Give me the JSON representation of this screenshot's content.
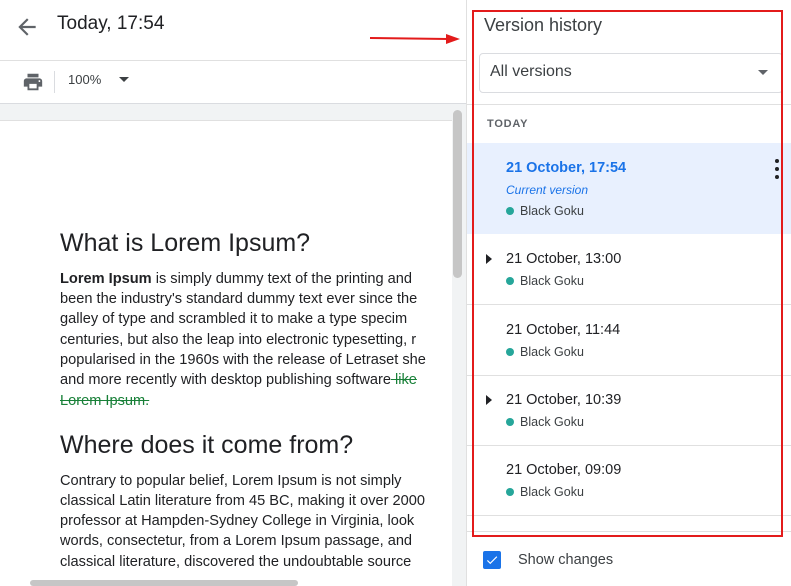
{
  "header": {
    "title": "Today, 17:54",
    "back_icon": "arrow-back-icon"
  },
  "toolbar": {
    "print_icon": "print-icon",
    "zoom": "100%"
  },
  "document": {
    "heading1": "What is Lorem Ipsum?",
    "para1": {
      "bold_lead": "Lorem Ipsum",
      "line1_rest": " is simply dummy text of the printing and",
      "line2": "been the industry's standard dummy text ever since the",
      "line3": "galley of type and scrambled it to make a type specim",
      "line4": "centuries, but also the leap into electronic typesetting, r",
      "line5": "popularised in the 1960s with the release of Letraset she",
      "line6": "and more recently with desktop publishing software",
      "line6_deleted": " like",
      "line7_deleted": "Lorem Ipsum."
    },
    "heading2": "Where does it come from?",
    "para2": {
      "line1": "Contrary to popular belief, Lorem Ipsum is not simply",
      "line2": "classical Latin literature from 45 BC, making it over 2000",
      "line3": "professor at Hampden-Sydney College in Virginia, look",
      "line4": "words, consectetur, from a Lorem Ipsum passage, and",
      "line5": "classical literature, discovered the undoubtable source"
    }
  },
  "panel": {
    "title": "Version history",
    "filter_value": "All versions",
    "section": "TODAY",
    "versions": [
      {
        "date": "21 October, 17:54",
        "current": "Current version",
        "author": "Black Goku",
        "expandable": false,
        "active": true
      },
      {
        "date": "21 October, 13:00",
        "author": "Black Goku",
        "expandable": true,
        "active": false
      },
      {
        "date": "21 October, 11:44",
        "author": "Black Goku",
        "expandable": false,
        "active": false
      },
      {
        "date": "21 October, 10:39",
        "author": "Black Goku",
        "expandable": true,
        "active": false
      },
      {
        "date": "21 October, 09:09",
        "author": "Black Goku",
        "expandable": false,
        "active": false
      }
    ],
    "show_changes_label": "Show changes",
    "show_changes_checked": true
  },
  "colors": {
    "accent": "#1a73e8",
    "author_dot": "#26a69a",
    "active_bg": "#e8f0fe",
    "annotation": "#e31b1b",
    "deleted_text": "#188038"
  }
}
